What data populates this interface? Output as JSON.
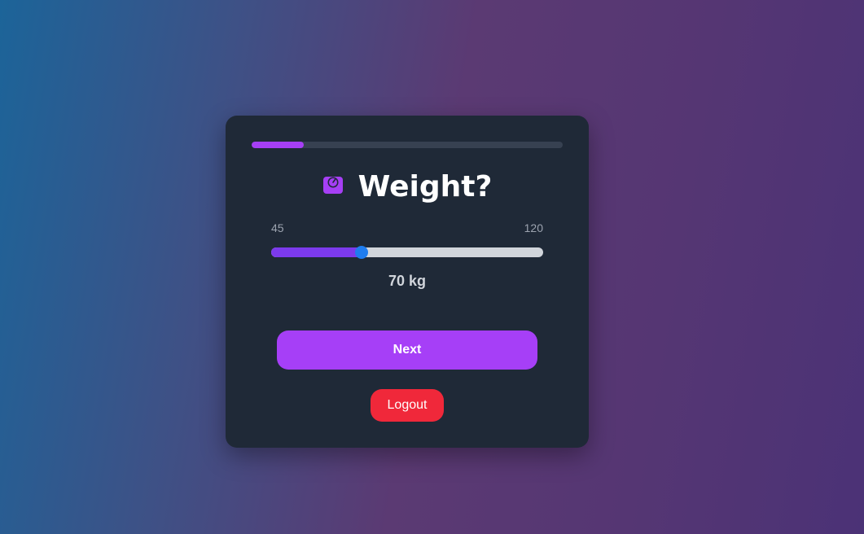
{
  "progress": {
    "fraction": 0.167,
    "color": "#a63ff5"
  },
  "header": {
    "icon": "weight-scale-icon",
    "title": "Weight?"
  },
  "slider": {
    "min_label": "45",
    "max_label": "120",
    "min": 45,
    "max": 120,
    "value": 70,
    "value_label": "70 kg",
    "fill_color": "#7c3aed",
    "thumb_color": "#1f7df0"
  },
  "actions": {
    "next_label": "Next",
    "logout_label": "Logout"
  },
  "colors": {
    "card": "#1f2937",
    "accent": "#a63ff7",
    "danger": "#f0283a"
  }
}
